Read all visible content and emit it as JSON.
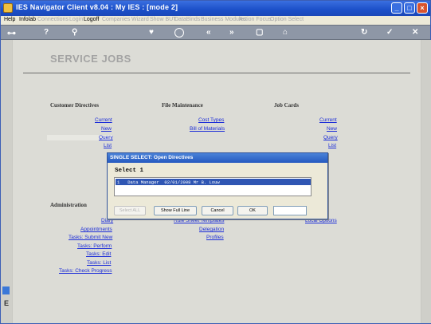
{
  "window": {
    "title": "IES Navigator Client v8.04 : My IES :      [mode 2]"
  },
  "menubar": {
    "items": [
      {
        "label": "Help",
        "enabled": true
      },
      {
        "label": "Infolab",
        "enabled": true
      },
      {
        "label": "Connections",
        "enabled": false
      },
      {
        "label": "Login",
        "enabled": false
      },
      {
        "label": "Logoff",
        "enabled": true
      },
      {
        "label": "Companies",
        "enabled": false
      },
      {
        "label": "Wizard",
        "enabled": false
      },
      {
        "label": "Show BUT",
        "enabled": false
      },
      {
        "label": "DataBinds",
        "enabled": false
      },
      {
        "label": "Business Modules",
        "enabled": false
      },
      {
        "label": "Action Focus",
        "enabled": false
      },
      {
        "label": "Option Select",
        "enabled": false
      }
    ]
  },
  "toolbar": {
    "icons": [
      "key-icon",
      "help-icon",
      "search-icon",
      "heart-icon",
      "history-icon",
      "back-icon",
      "forward-icon",
      "stop-icon",
      "home-icon",
      "sync-icon",
      "ok-icon",
      "close-icon"
    ]
  },
  "page": {
    "title": "SERVICE JOBS"
  },
  "sections": {
    "customer_directives": {
      "heading": "Customer Directives",
      "links": [
        "Current",
        "New",
        "Query",
        "List"
      ]
    },
    "file_maintenance": {
      "heading": "File Maintenance",
      "links": [
        "Cost Types",
        "Bill of Materials"
      ]
    },
    "job_cards": {
      "heading": "Job Cards",
      "links": [
        "Current",
        "New",
        "Query",
        "List"
      ]
    },
    "administration": {
      "heading": "Administration",
      "links": [
        "Diary",
        "Appointments",
        "Tasks: Submit New",
        "Tasks: Perform",
        "Tasks: Edit",
        "Tasks: List",
        "Tasks: Check Progress"
      ]
    },
    "admin_middle": {
      "links": [
        "Rule Sheet Templates",
        "Delegation",
        "Profiles"
      ]
    },
    "admin_right": {
      "links": [
        "Local Options"
      ]
    }
  },
  "dialog": {
    "title": "SINGLE SELECT: Open Directives",
    "prompt": "Select 1",
    "rows": [
      "1   Data Manager  02/01/2008 Mr B. Louw"
    ],
    "buttons": {
      "select_all": "Select ALL",
      "show_full_line": "Show Full Line",
      "cancel": "Cancel",
      "ok": "OK"
    },
    "filter_value": ""
  }
}
